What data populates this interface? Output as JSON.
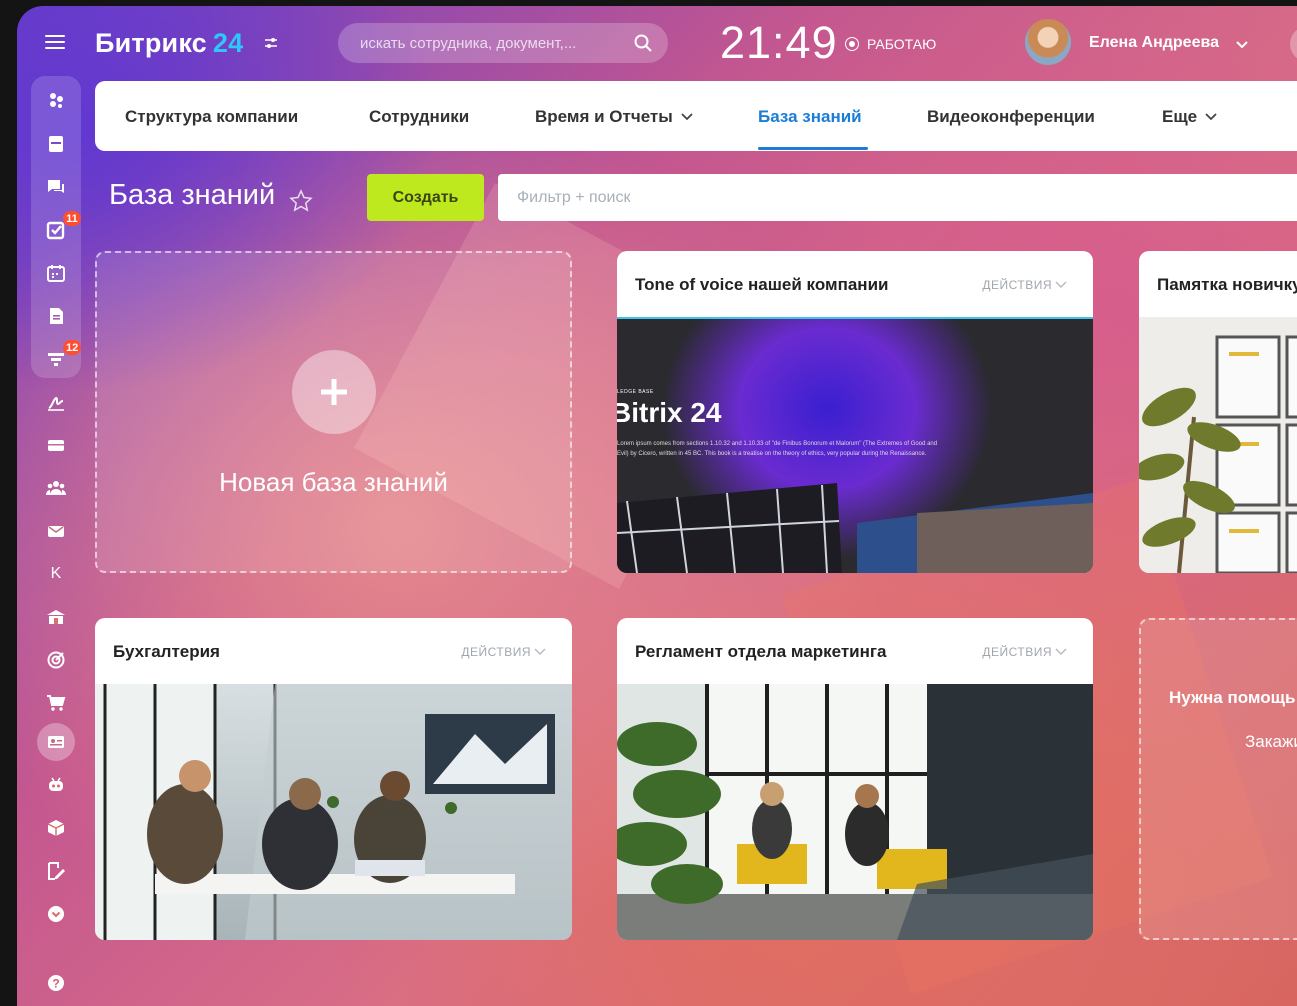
{
  "header": {
    "logo_text": "Битрикс",
    "logo_number": "24",
    "search_placeholder": "искать сотрудника, документ,...",
    "time": "21:49",
    "status": "РАБОТАЮ",
    "user_name": "Елена Андреева"
  },
  "sidebar": {
    "badges": {
      "tasks": "11",
      "feed": "12"
    },
    "letter_item": "K"
  },
  "tabs": [
    {
      "label": "Структура компании"
    },
    {
      "label": "Сотрудники"
    },
    {
      "label": "Время и Отчеты"
    },
    {
      "label": "База знаний"
    },
    {
      "label": "Видеоконференции"
    },
    {
      "label": "Еще"
    }
  ],
  "page": {
    "title": "База знаний",
    "create_label": "Создать",
    "filter_placeholder": "Фильтр + поиск"
  },
  "cards": {
    "new_label": "Новая база знаний",
    "actions_label": "ДЕЙСТВИЯ",
    "items": [
      {
        "title": "Tone of voice нашей компании"
      },
      {
        "title": "Памятка новичку"
      },
      {
        "title": "Бухгалтерия"
      },
      {
        "title": "Регламент отдела маркетинга"
      }
    ],
    "preview": {
      "kicker": "LEDGE BASE",
      "headline": "Bitrix 24",
      "body": "Lorem ipsum comes from sections 1.10.32 and 1.10.33 of \"de Finibus Bonorum et Malorum\" (The Extremes of Good and Evil) by Cicero, written in 45 BC. This book is a treatise on the theory of ethics, very popular during the Renaissance."
    },
    "help_title": "Нужна помощь",
    "help_sub": "Закажите"
  },
  "colors": {
    "accent": "#1b7dd7",
    "create": "#bfe91f",
    "badge": "#ff4d2e",
    "logo_number": "#2fc7f7"
  }
}
